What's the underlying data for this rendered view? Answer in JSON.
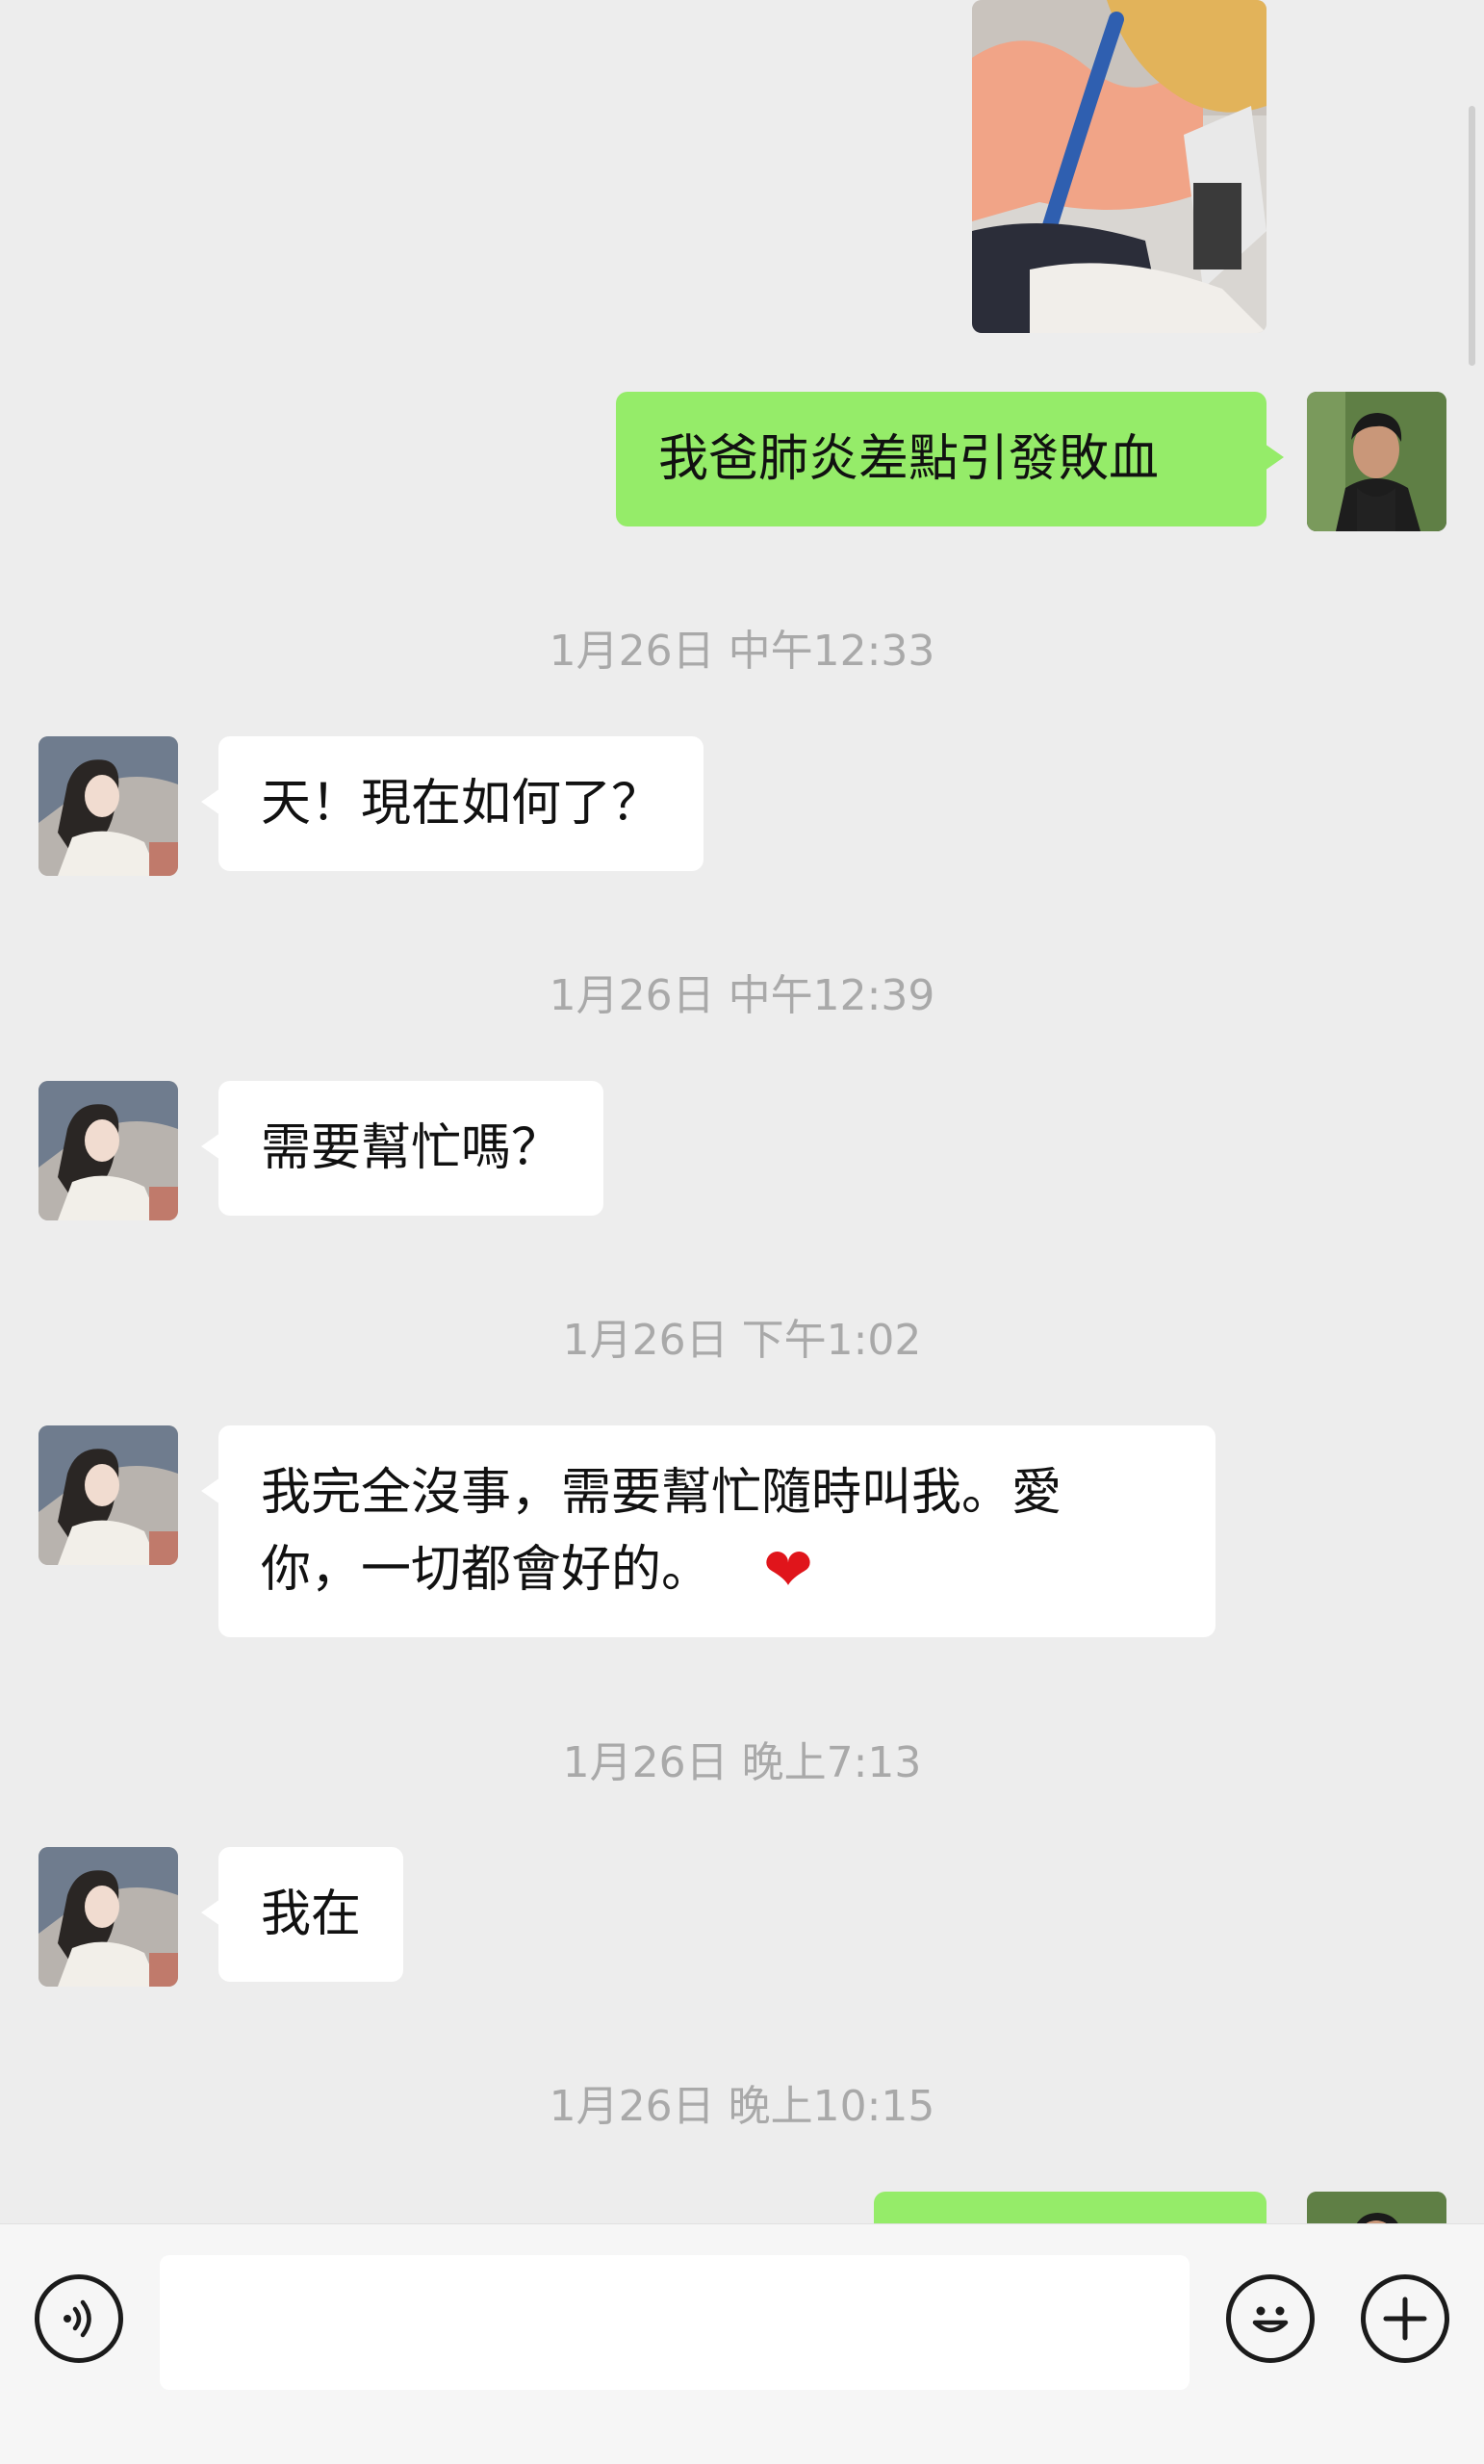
{
  "conversation": {
    "messages": [
      {
        "id": "m1",
        "sender": "me",
        "type": "image",
        "description_icon": "photo-thumbnail"
      },
      {
        "id": "m2",
        "sender": "me",
        "type": "text",
        "text": "我爸肺炎差點引發敗血"
      },
      {
        "id": "t1",
        "type": "timestamp",
        "text": "1月26日 中午12:33"
      },
      {
        "id": "m3",
        "sender": "her",
        "type": "text",
        "text": "天！現在如何了？"
      },
      {
        "id": "t2",
        "type": "timestamp",
        "text": "1月26日 中午12:39"
      },
      {
        "id": "m4",
        "sender": "her",
        "type": "text",
        "text": "需要幫忙嗎？"
      },
      {
        "id": "t3",
        "type": "timestamp",
        "text": "1月26日 下午1:02"
      },
      {
        "id": "m5",
        "sender": "her",
        "type": "text",
        "line1": "我完全沒事，需要幫忙隨時叫我。愛",
        "line2": "你，一切都會好的。",
        "emoji": "❤"
      },
      {
        "id": "t4",
        "type": "timestamp",
        "text": "1月26日 晚上7:13"
      },
      {
        "id": "m6",
        "sender": "her",
        "type": "text",
        "text": "我在"
      },
      {
        "id": "t5",
        "type": "timestamp",
        "text": "1月26日 晚上10:15"
      }
    ]
  },
  "input_bar": {
    "voice_icon": "voice-icon",
    "emoji_icon": "emoji-icon",
    "plus_icon": "plus-icon",
    "message_value": ""
  },
  "colors": {
    "background": "#ededed",
    "outgoing_bubble": "#95ec69",
    "incoming_bubble": "#ffffff",
    "timestamp_text": "#a9a9a9",
    "heart": "#e0151b"
  }
}
